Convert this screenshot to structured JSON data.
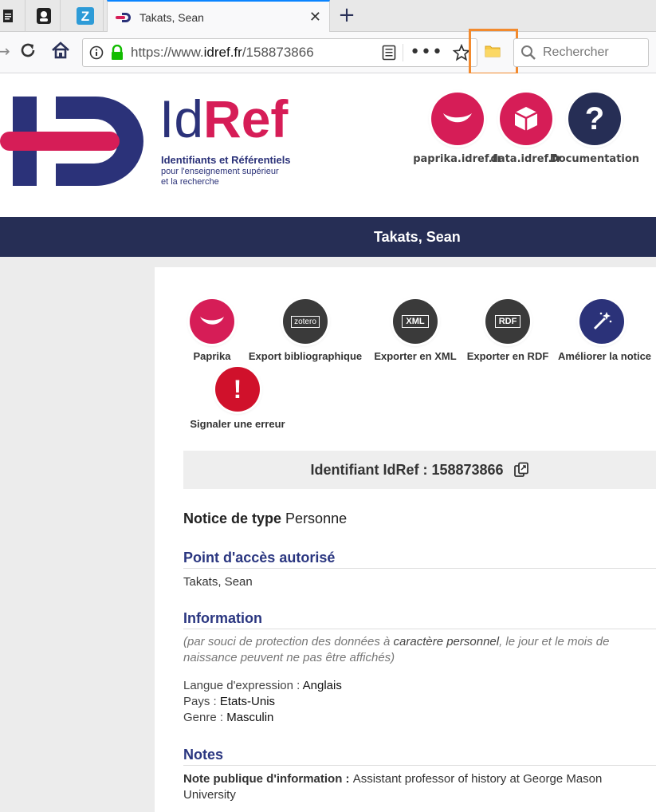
{
  "browser": {
    "active_tab_title": "Takats, Sean",
    "url_prefix": "https://www.",
    "url_domain": "idref.fr",
    "url_path": "/158873866",
    "search_placeholder": "Rechercher",
    "new_tab_symbol": "+",
    "close_symbol": "✕"
  },
  "header": {
    "logo_id": "Id",
    "logo_ref": "Ref",
    "logo_subtitle": "Identifiants et Référentiels",
    "logo_subtitle2": "pour l'enseignement supérieur",
    "logo_subtitle3": "et la recherche",
    "links": [
      {
        "label": "paprika.idref.fr",
        "icon": "paprika-icon",
        "color": "#d61d57"
      },
      {
        "label": "data.idref.fr",
        "icon": "cube-icon",
        "color": "#d61d57"
      },
      {
        "label": "Documentation",
        "icon": "question-icon",
        "color": "#262e55",
        "glyph": "?"
      }
    ]
  },
  "title_band": "Takats, Sean",
  "actions": [
    {
      "label": "Paprika",
      "icon": "paprika-icon",
      "color": "#d61d57"
    },
    {
      "label": "Export bibliographique",
      "icon": "zotero-icon",
      "color": "#3a3a3a",
      "glyph": "zotero"
    },
    {
      "label": "Exporter en XML",
      "icon": "xml-icon",
      "color": "#3a3a3a",
      "glyph": "XML"
    },
    {
      "label": "Exporter en RDF",
      "icon": "rdf-icon",
      "color": "#3a3a3a",
      "glyph": "RDF"
    },
    {
      "label": "Améliorer la notice",
      "icon": "magic-wand-icon",
      "color": "#2b3279"
    },
    {
      "label": "Signaler une erreur",
      "icon": "exclamation-icon",
      "color": "#d0112b",
      "glyph": "!"
    }
  ],
  "identifier": {
    "label": "Identifiant IdRef : 158873866"
  },
  "notice_type": {
    "label": "Notice de type",
    "value": "Personne"
  },
  "sections": {
    "access_point": {
      "title": "Point d'accès autorisé",
      "value": "Takats, Sean"
    },
    "information": {
      "title": "Information",
      "note_part1": "(par souci de protection des données à ",
      "note_em": "caractère personnel",
      "note_part2": ", le jour et le mois de naissance peuvent ne pas être affichés)",
      "fields": [
        {
          "key": "Langue d'expression : ",
          "value": "Anglais"
        },
        {
          "key": "Pays : ",
          "value": "Etats-Unis"
        },
        {
          "key": "Genre : ",
          "value": "Masculin"
        }
      ]
    },
    "notes": {
      "title": "Notes",
      "key": "Note publique d'information : ",
      "value": "Assistant professor of history at George Mason University"
    }
  }
}
